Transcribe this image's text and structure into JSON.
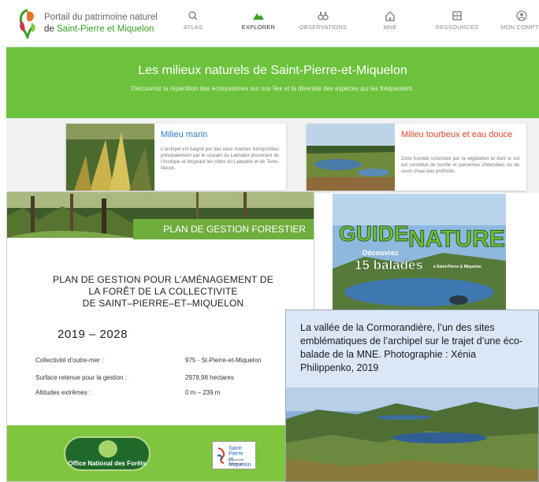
{
  "portal": {
    "title_line1": "Portail du patrimoine naturel",
    "title_line2_prefix": "de ",
    "title_line2_place": "Saint-Pierre et Miquelon"
  },
  "nav": [
    {
      "label": "ATLAS",
      "icon": "search-icon"
    },
    {
      "label": "EXPLORER",
      "icon": "mountain-icon",
      "active": true
    },
    {
      "label": "OBSERVATIONS",
      "icon": "binoculars-icon"
    },
    {
      "label": "MNE",
      "icon": "house-icon"
    },
    {
      "label": "RESSOURCES",
      "icon": "archive-icon"
    },
    {
      "label": "MON COMPTE",
      "icon": "user-icon"
    }
  ],
  "hero": {
    "title": "Les milieux naturels de Saint-Pierre-et-Miquelon",
    "subtitle": "Découvrez la répartition des écosystèmes sur nos îles et la diversité des espèces qui les fréquentent."
  },
  "cards": [
    {
      "title": "Milieu marin",
      "text": "L'archipel est baigné par des eaux marines transportées principalement par le courant du Labrador provenant de l'Arctique et longeant les côtes du Labrador et de Terre-Neuve.",
      "title_color": "#2b7bc0"
    },
    {
      "title": "Milieu tourbeux et eau douce",
      "text": "Zone humide colonisée par la végétation et dont le sol est constitué de tourbe et parsemée d'étendues ou de cours d'eau peu profonds.",
      "title_color": "#d9442b"
    }
  ],
  "plan": {
    "band": "PLAN DE GESTION FORESTIER",
    "title_line1": "PLAN DE GESTION POUR L’AMÉNAGEMENT DE",
    "title_line2": "LA FORÊT DE LA COLLECTIVITE",
    "title_line3": "DE SAINT–PIERRE–ET–MIQUELON",
    "years": "2019 – 2028",
    "rows": [
      {
        "label": "Collectivité d’outre-mer :",
        "value": "975 - St-Pierre-et-Miquelon"
      },
      {
        "label": "Surface retenue pour la gestion :",
        "value": "2978,98 hectares"
      },
      {
        "label": "Altitudes extrêmes :",
        "value": "0 m – 239 m"
      }
    ],
    "onf_logo": "Office National des Forêts",
    "spm_logo_line1": "Saint-Pierre",
    "spm_logo_line2": "et Miquelon",
    "spm_logo_line3": "Collectivité Territoriale"
  },
  "guide": {
    "word1": "GUIDE",
    "word2": "NATURE",
    "line1": "Découvrez",
    "line2": "15 balades",
    "line3": "à Saint-Pierre & Miquelon"
  },
  "caption": {
    "text": "La vallée de la Cormorandière, l’un des sites emblématiques de l’archipel sur le trajet d’une éco-balade de la MNE. Photographie : Xénia Philippenko, 2019"
  },
  "colors": {
    "accent_green": "#6cc23a",
    "title_green": "#3a9d23",
    "marine_blue": "#2b7bc0",
    "peat_red": "#d9442b"
  }
}
